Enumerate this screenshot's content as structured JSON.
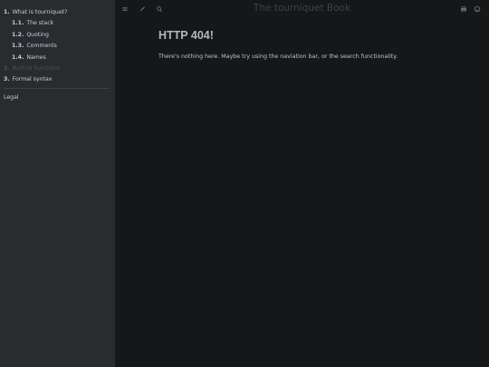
{
  "sidebar": {
    "items": [
      {
        "num": "1.",
        "label": "What is tourniquet?",
        "level": 0,
        "disabled": false
      },
      {
        "num": "1.1.",
        "label": "The stack",
        "level": 1,
        "disabled": false
      },
      {
        "num": "1.2.",
        "label": "Quoting",
        "level": 1,
        "disabled": false
      },
      {
        "num": "1.3.",
        "label": "Comments",
        "level": 1,
        "disabled": false
      },
      {
        "num": "1.4.",
        "label": "Names",
        "level": 1,
        "disabled": false
      },
      {
        "num": "2.",
        "label": "Built-in functions",
        "level": 0,
        "disabled": true
      },
      {
        "num": "3.",
        "label": "Formal syntax",
        "level": 0,
        "disabled": false
      }
    ],
    "footer_item": "Legal"
  },
  "header": {
    "title": "The tourniquet Book",
    "icons": [
      "menu-icon",
      "brush-icon",
      "search-icon",
      "print-icon",
      "github-icon"
    ]
  },
  "main": {
    "heading": "HTTP 404!",
    "message": "There's nothing here. Maybe try using the naviation bar, or the search functionality."
  }
}
